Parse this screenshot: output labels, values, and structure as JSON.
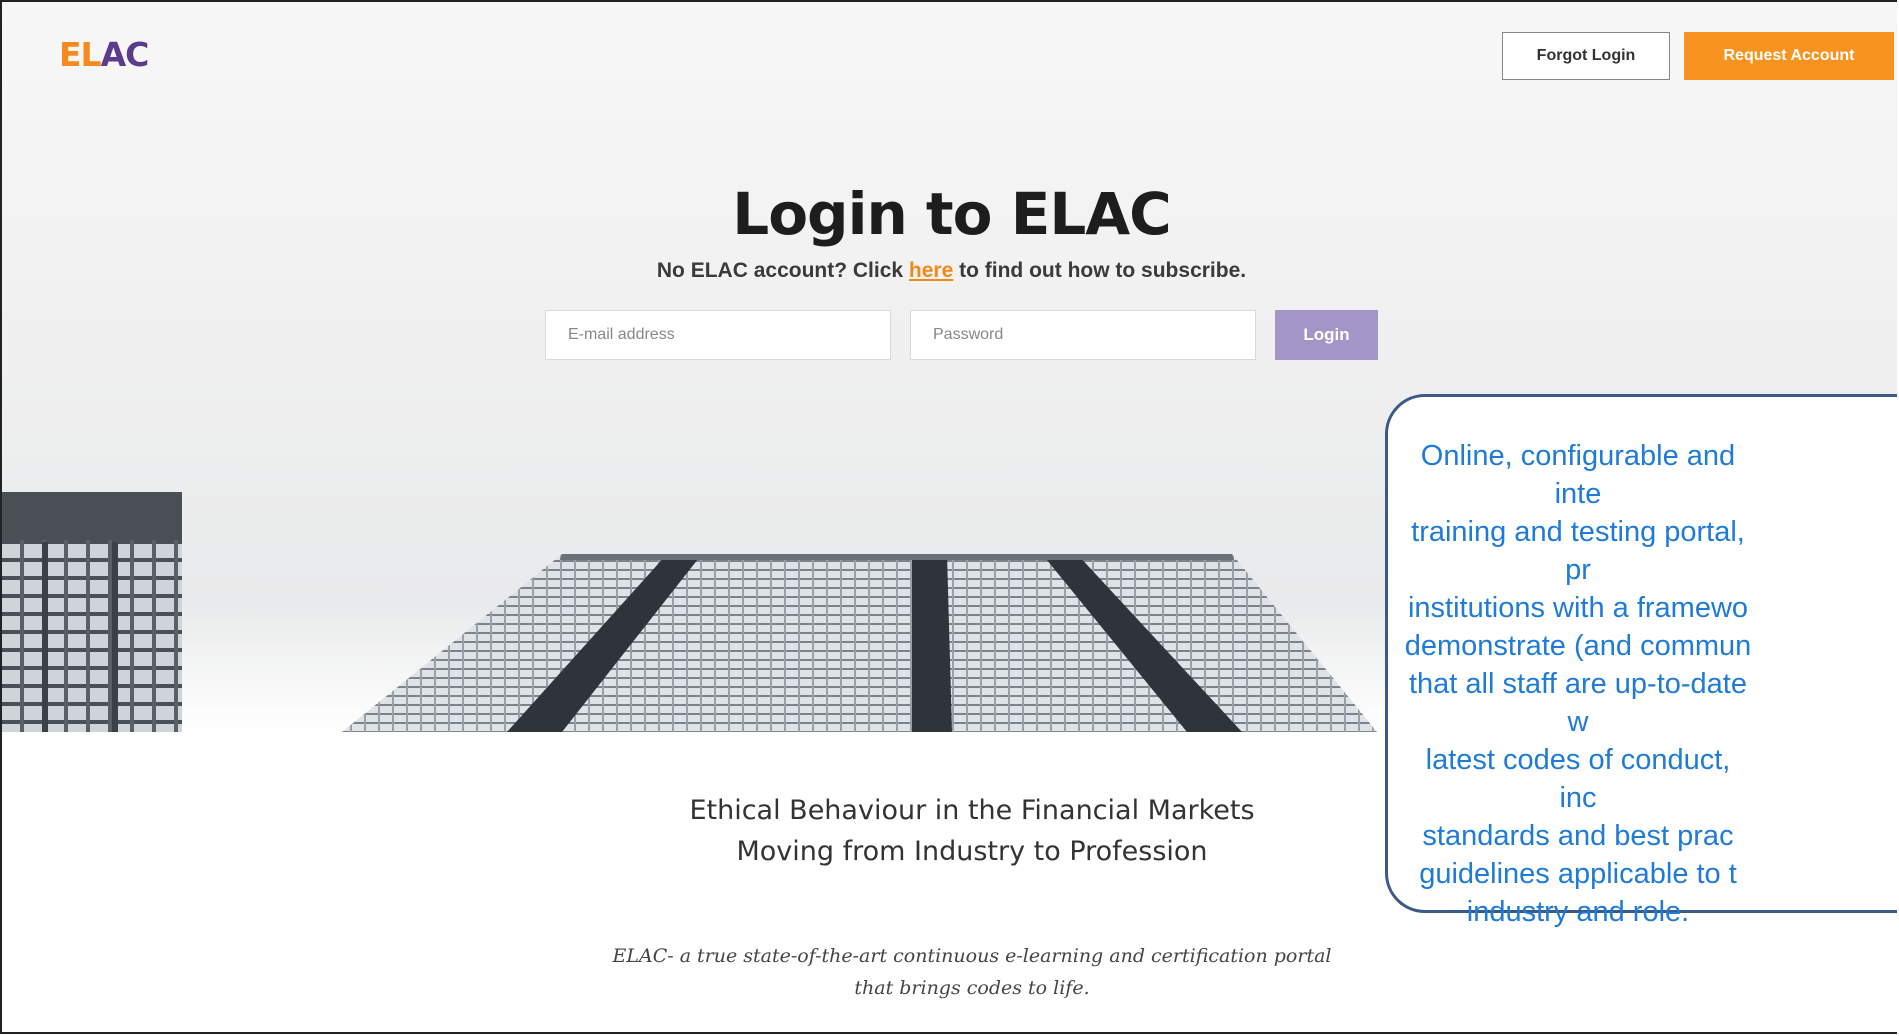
{
  "brand": {
    "logo_part1": "EL",
    "logo_part2": "AC"
  },
  "header": {
    "forgot_label": "Forgot Login",
    "request_label": "Request Account"
  },
  "login": {
    "title": "Login to ELAC",
    "subtitle_before": "No ELAC account? Click ",
    "subtitle_link": "here",
    "subtitle_after": " to find out how to subscribe.",
    "email_placeholder": "E-mail address",
    "password_placeholder": "Password",
    "login_label": "Login"
  },
  "tagline": {
    "line1": "Ethical Behaviour in the Financial Markets",
    "line2": "Moving from Industry to Profession"
  },
  "description": {
    "line1": "ELAC- a true state-of-the-art continuous e-learning and certification portal",
    "line2": "that brings codes to life."
  },
  "callout": {
    "text": "Online, configurable and inte\ntraining and testing portal, pr\ninstitutions with a framewo\ndemonstrate (and commun\nthat all staff are up-to-date w\nlatest codes of conduct, inc\nstandards and best prac\nguidelines applicable to t\nindustry and role."
  },
  "colors": {
    "orange": "#f7931e",
    "purple": "#5a3b8c",
    "login_button": "#a396c6",
    "callout_text": "#1f7bd8",
    "callout_border": "#3b5a8a"
  }
}
